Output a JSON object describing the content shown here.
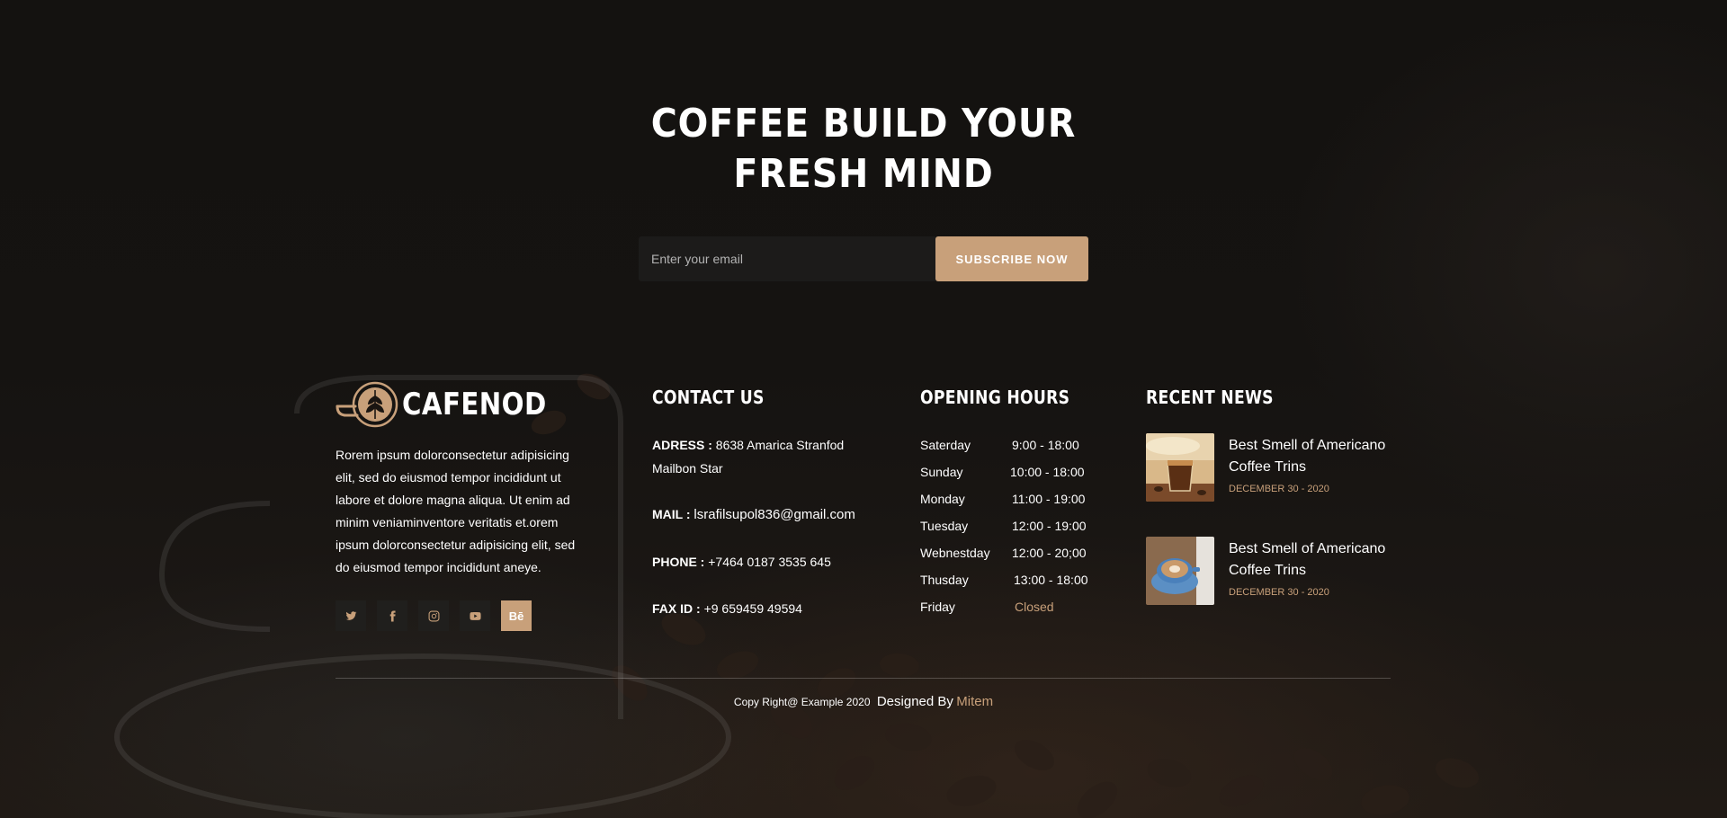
{
  "hero": {
    "title_line1": "COFFEE BUILD YOUR",
    "title_line2": "FRESH MIND",
    "email_placeholder": "Enter your email",
    "subscribe_label": "SUBSCRIBE NOW"
  },
  "brand": {
    "name": "CAFENOD",
    "description": "Rorem ipsum dolorconsectetur adipisicing elit, sed do eiusmod tempor incididunt ut labore et dolore magna aliqua. Ut enim ad minim veniaminventore veritatis et.orem ipsum dolorconsectetur adipisicing elit, sed do eiusmod tempor incididunt aneye.",
    "social": [
      {
        "name": "twitter-icon"
      },
      {
        "name": "facebook-icon"
      },
      {
        "name": "instagram-icon"
      },
      {
        "name": "youtube-icon"
      },
      {
        "name": "behance-icon",
        "label": "Bē"
      }
    ]
  },
  "contact": {
    "title": "CONTACT US",
    "address_label": "ADRESS :",
    "address_value": "8638 Amarica Stranfod Mailbon Star",
    "mail_label": "MAIL :",
    "mail_value": "lsrafilsupol836@gmail.com",
    "phone_label": "PHONE :",
    "phone_value": "+7464 0187 3535 645",
    "fax_label": "FAX ID :",
    "fax_value": "+9 659459 49594"
  },
  "hours": {
    "title": "OPENING HOURS",
    "rows": [
      {
        "day": "Saterday",
        "time": "9:00 - 18:00"
      },
      {
        "day": "Sunday",
        "time": "10:00 - 18:00"
      },
      {
        "day": "Monday",
        "time": "11:00 - 19:00"
      },
      {
        "day": "Tuesday",
        "time": "12:00 - 19:00"
      },
      {
        "day": "Webnestday",
        "time": "12:00 - 20;00"
      },
      {
        "day": "Thusday",
        "time": "13:00 - 18:00"
      },
      {
        "day": "Friday",
        "time": "Closed"
      }
    ]
  },
  "news": {
    "title": "RECENT NEWS",
    "items": [
      {
        "title": "Best Smell of Americano Coffee Trins",
        "date": "DECEMBER 30 - 2020"
      },
      {
        "title": "Best Smell of Americano Coffee Trins",
        "date": "DECEMBER 30 - 2020"
      }
    ]
  },
  "footer": {
    "copyright": "Copy Right@ Example 2020",
    "designed_by": "Designed By",
    "author": "Mitem"
  },
  "colors": {
    "accent": "#c8a07a",
    "background": "#141210"
  }
}
